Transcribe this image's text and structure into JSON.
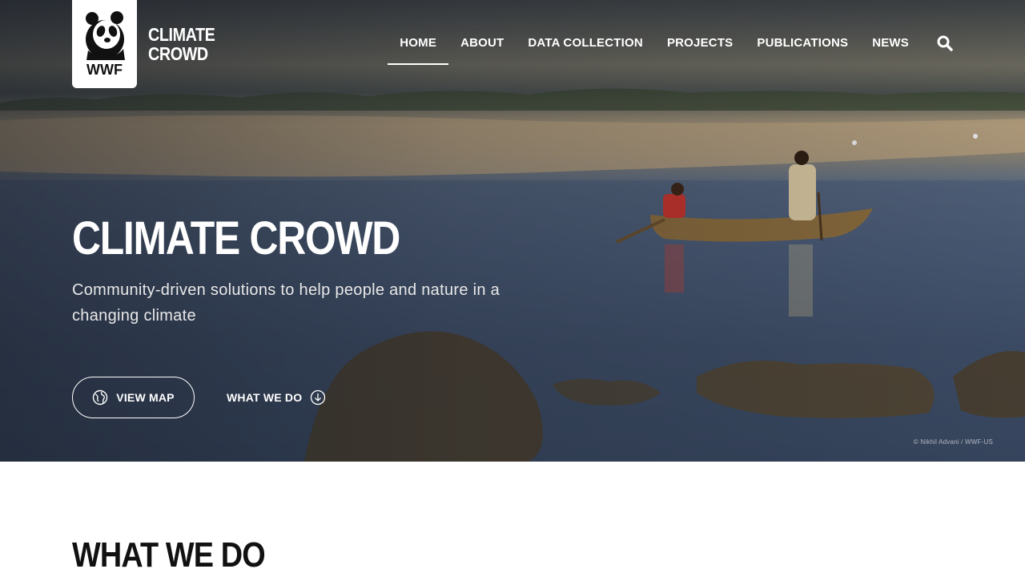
{
  "brand": {
    "logo_text": "WWF",
    "name_line1": "CLIMATE",
    "name_line2": "CROWD"
  },
  "nav": {
    "items": [
      {
        "label": "HOME",
        "active": true
      },
      {
        "label": "ABOUT",
        "active": false
      },
      {
        "label": "DATA COLLECTION",
        "active": false
      },
      {
        "label": "PROJECTS",
        "active": false
      },
      {
        "label": "PUBLICATIONS",
        "active": false
      },
      {
        "label": "NEWS",
        "active": false
      }
    ],
    "search_icon": "search-icon"
  },
  "hero": {
    "title": "CLIMATE CROWD",
    "subtitle": "Community-driven solutions to help people and nature in a changing climate",
    "primary_button": {
      "label": "VIEW MAP",
      "icon": "globe-icon"
    },
    "secondary_button": {
      "label": "WHAT WE DO",
      "icon": "arrow-down-circle-icon"
    },
    "photo_credit": "© Nikhil Advani / WWF-US"
  },
  "section": {
    "title": "WHAT WE DO"
  },
  "colors": {
    "text_light": "#ffffff",
    "heading_dark": "#111111",
    "water": "#4d5d78"
  }
}
